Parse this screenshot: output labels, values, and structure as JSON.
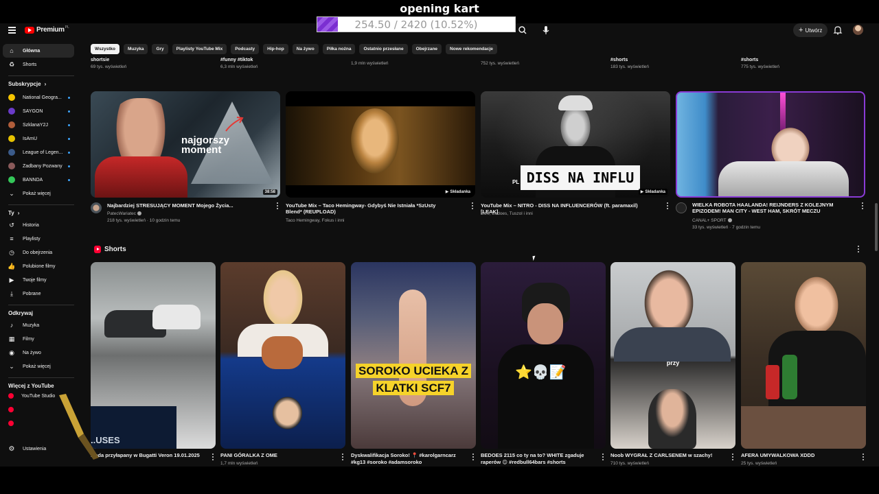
{
  "overlay": {
    "title": "opening kart",
    "progress_text": "254.50 / 2420 (10.52%)",
    "progress_value": 0.1052,
    "progress_color": "#7b2fd1"
  },
  "header": {
    "logo_text": "Premium",
    "logo_region": "PL",
    "create_label": "Utwórz",
    "icons": [
      "menu-icon",
      "search-icon",
      "mic-icon",
      "plus-icon",
      "bell-icon"
    ]
  },
  "sidebar": {
    "main": [
      {
        "label": "Główna",
        "icon": "home-icon"
      },
      {
        "label": "Shorts",
        "icon": "shorts-icon"
      }
    ],
    "subscriptions_header": "Subskrypcje",
    "subscriptions": [
      {
        "label": "National Geogra...",
        "color": "#f5c400"
      },
      {
        "label": "SAYGON",
        "color": "#6a3bc8"
      },
      {
        "label": "SzklanaY2J",
        "color": "#b05d3a"
      },
      {
        "label": "IsAmU",
        "color": "#e6c200"
      },
      {
        "label": "League of Legen...",
        "color": "#3b5b8a"
      },
      {
        "label": "Zadbany Pozwany",
        "color": "#8a5a5a"
      },
      {
        "label": "BANNDA",
        "color": "#34c759"
      },
      {
        "label": "Pokaż więcej",
        "color": ""
      }
    ],
    "you_header": "Ty",
    "you": [
      {
        "label": "Historia",
        "icon": "history-icon"
      },
      {
        "label": "Playlisty",
        "icon": "playlist-icon"
      },
      {
        "label": "Do obejrzenia",
        "icon": "clock-icon"
      },
      {
        "label": "Polubione filmy",
        "icon": "like-icon"
      },
      {
        "label": "Twoje filmy",
        "icon": "video-icon"
      },
      {
        "label": "Pobrane",
        "icon": "download-icon"
      }
    ],
    "explore_header": "Odkrywaj",
    "explore": [
      {
        "label": "Muzyka",
        "icon": "music-icon"
      },
      {
        "label": "Filmy",
        "icon": "film-icon"
      },
      {
        "label": "Na żywo",
        "icon": "live-icon"
      },
      {
        "label": "Pokaż więcej",
        "icon": "chevron-down-icon"
      }
    ],
    "more_header": "Więcej z YouTube",
    "more": [
      {
        "label": "YouTube Studio"
      },
      {
        "label": ""
      },
      {
        "label": ""
      }
    ],
    "settings_label": "Ustawienia"
  },
  "chips": [
    "Wszystko",
    "Muzyka",
    "Gry",
    "Playlisty YouTube Mix",
    "Podcasty",
    "Hip-hop",
    "Na żywo",
    "Piłka nożna",
    "Ostatnio przesłane",
    "Obejrzane",
    "Nowe rekomendacje"
  ],
  "prev_row": [
    {
      "title": "shortsie",
      "views": "69 tys. wyświetleń"
    },
    {
      "title": "#funny #tiktok",
      "views": "6,3 mln wyświetleń"
    },
    {
      "title": "",
      "views": "1,9 mln wyświetleń"
    },
    {
      "title": "",
      "views": "752 tys. wyświetleń"
    },
    {
      "title": "#shorts",
      "views": "183 tys. wyświetleń"
    },
    {
      "title": "#shorts",
      "views": "775 tys. wyświetleń"
    }
  ],
  "videos": [
    {
      "title": "Najbardziej STRESUJĄCY MOMENT Mojego Życia...",
      "channel": "PatecWariatec",
      "meta": "218 tys. wyświetleń · 10 godzin temu",
      "duration": "38:58",
      "thumb_text_1": "najgorszy",
      "thumb_text_2": "moment"
    },
    {
      "title": "YouTube Mix – Taco Hemingway- Gdybyś Nie Istniała *SzUsty Blend* (REUPLOAD)",
      "channel": "Taco Hemingway, Fokus i inni",
      "meta": "",
      "duration": "Składanka"
    },
    {
      "title": "YouTube Mix – NITRO - DISS NA INFLUENCERÓW (ft. paramaxil) [LEAK]",
      "channel": "Kizo, Bedoes, Tuszol i inni",
      "meta": "",
      "duration": "Składanka",
      "thumb_text_1": "DISS NA INFLU",
      "thumb_text_2": "PL"
    },
    {
      "title": "WIELKA ROBOTA HAALANDA! REIJNDERS Z KOLEJNYM EPIZODEM! MAN CITY - WEST HAM, SKRÓT MECZU",
      "channel": "CANAL+ SPORT",
      "meta": "33 tys. wyświetleń · 7 godzin temu",
      "duration": ""
    }
  ],
  "shorts_header": "Shorts",
  "shorts": [
    {
      "title": "...ęda przyłapany w Bugatti Veron 19.01.2025",
      "views": "",
      "overlay": "..USES"
    },
    {
      "title": "PANI GÓRALKA Z OME",
      "views": "1,7 mln wyświetleń",
      "overlay": ""
    },
    {
      "title": "Dyskwalifikacja Soroko! 📍 #karolgarncarz #kg13 #soroko #adamsoroko",
      "views": "",
      "overlay": "SOROKO UCIEKA Z KLATKI SCF7"
    },
    {
      "title": "BEDOES 2115 co ty na to? WHITE zgaduje raperów 😊 #redbull64bars #shorts",
      "views": "",
      "overlay": "⭐💀📝"
    },
    {
      "title": "Noob WYGRAŁ Z CARLSENEM w szachy!",
      "views": "710 tys. wyświetleń",
      "overlay": "przy"
    },
    {
      "title": "AFERA UMYWALKOWA XDDD",
      "views": "25 tys. wyświetleń",
      "overlay": ""
    }
  ]
}
